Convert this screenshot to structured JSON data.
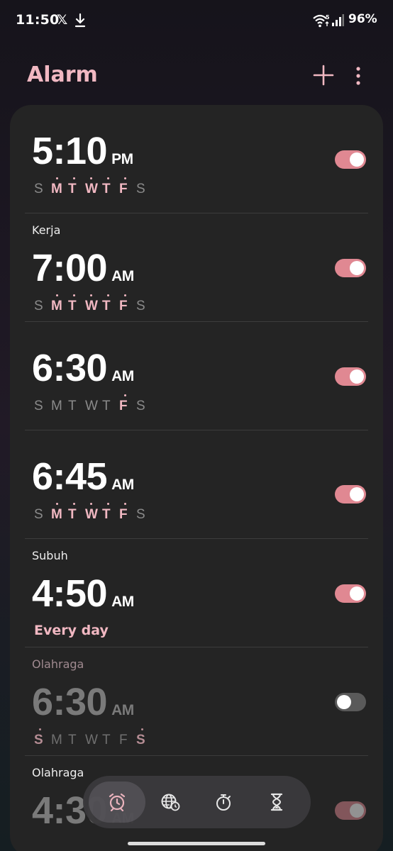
{
  "status_bar": {
    "time": "11:50",
    "x_logo": "𝕏",
    "battery": "96%",
    "icons": [
      "download-icon",
      "wifi-icon",
      "signal-icon"
    ]
  },
  "header": {
    "title": "Alarm",
    "add_icon": "plus-icon",
    "more_icon": "more-vert-icon"
  },
  "colors": {
    "accent": "#f1b8c2",
    "toggle_on": "#e08892",
    "card": "#242424"
  },
  "alarms": [
    {
      "label": "",
      "time": "5:10",
      "ampm": "PM",
      "days": [
        "S",
        "M",
        "T",
        "W",
        "T",
        "F",
        "S"
      ],
      "selected": [
        false,
        true,
        true,
        true,
        true,
        true,
        false
      ],
      "enabled": true
    },
    {
      "label": "Kerja",
      "time": "7:00",
      "ampm": "AM",
      "days": [
        "S",
        "M",
        "T",
        "W",
        "T",
        "F",
        "S"
      ],
      "selected": [
        false,
        true,
        true,
        true,
        true,
        true,
        false
      ],
      "enabled": true
    },
    {
      "label": "",
      "time": "6:30",
      "ampm": "AM",
      "days": [
        "S",
        "M",
        "T",
        "W",
        "T",
        "F",
        "S"
      ],
      "selected": [
        false,
        false,
        false,
        false,
        false,
        true,
        false
      ],
      "enabled": true
    },
    {
      "label": "",
      "time": "6:45",
      "ampm": "AM",
      "days": [
        "S",
        "M",
        "T",
        "W",
        "T",
        "F",
        "S"
      ],
      "selected": [
        false,
        true,
        true,
        true,
        true,
        true,
        false
      ],
      "enabled": true
    },
    {
      "label": "Subuh",
      "time": "4:50",
      "ampm": "AM",
      "repeat": "Every day",
      "enabled": true
    },
    {
      "label": "Olahraga",
      "time": "6:30",
      "ampm": "AM",
      "days": [
        "S",
        "M",
        "T",
        "W",
        "T",
        "F",
        "S"
      ],
      "selected": [
        true,
        false,
        false,
        false,
        false,
        false,
        true
      ],
      "enabled": false
    },
    {
      "label": "Olahraga",
      "time": "4:30",
      "ampm": "AM",
      "enabled": true
    }
  ],
  "bottom_nav": [
    {
      "name": "alarm",
      "icon": "alarm-clock-icon",
      "active": true
    },
    {
      "name": "world-clock",
      "icon": "globe-clock-icon",
      "active": false
    },
    {
      "name": "stopwatch",
      "icon": "stopwatch-icon",
      "active": false
    },
    {
      "name": "timer",
      "icon": "hourglass-icon",
      "active": false
    }
  ]
}
